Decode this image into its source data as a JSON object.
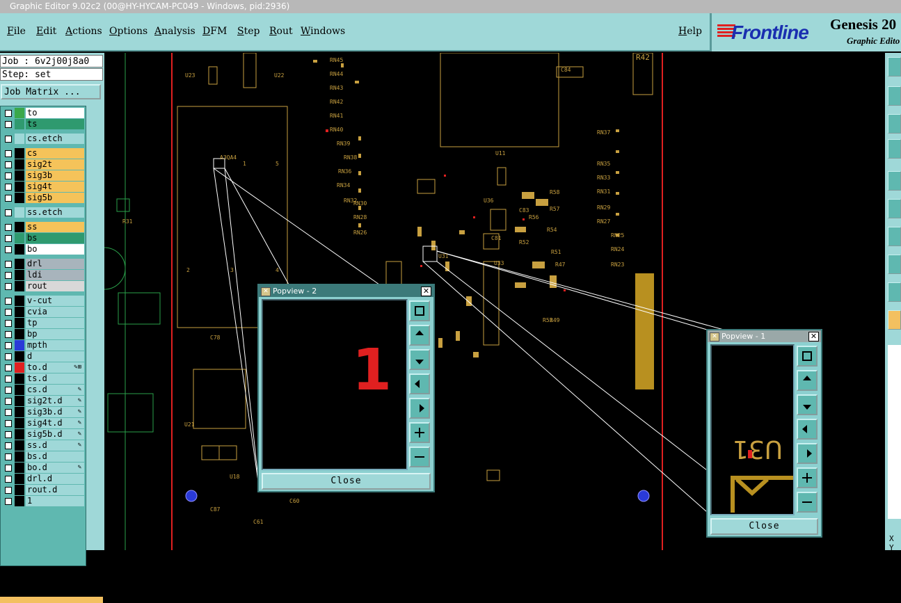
{
  "window": {
    "title": "Graphic Editor 9.02c2 (00@HY-HYCAM-PC049 - Windows, pid:2936)"
  },
  "menu": {
    "items": [
      "File",
      "Edit",
      "Actions",
      "Options",
      "Analysis",
      "DFM",
      "Step",
      "Rout",
      "Windows"
    ],
    "help": "Help"
  },
  "logo": {
    "brand": "Frontline",
    "product": "Genesis 20",
    "subtitle": "Graphic Edito"
  },
  "job": {
    "job_line": "Job : 6v2j00j8a0",
    "step_line": "Step: set",
    "job_matrix_button": "Job Matrix ..."
  },
  "layers": [
    {
      "name": "to",
      "color": "#ffffff",
      "swatch": "#3aa84a"
    },
    {
      "name": "ts",
      "color": "#2f9a6f",
      "swatch": "#2f9a6f"
    },
    {
      "name": "cs.etch",
      "color": "#9fd8d8",
      "swatch": "#9fd8d8"
    },
    {
      "name": "cs",
      "color": "#f5c35a",
      "swatch": "#000000"
    },
    {
      "name": "sig2t",
      "color": "#f5c35a",
      "swatch": "#000000"
    },
    {
      "name": "sig3b",
      "color": "#f5c35a",
      "swatch": "#000000"
    },
    {
      "name": "sig4t",
      "color": "#f5c35a",
      "swatch": "#000000"
    },
    {
      "name": "sig5b",
      "color": "#f5c35a",
      "swatch": "#000000"
    },
    {
      "name": "ss.etch",
      "color": "#9fd8d8",
      "swatch": "#9fd8d8"
    },
    {
      "name": "ss",
      "color": "#f5c35a",
      "swatch": "#000000"
    },
    {
      "name": "bs",
      "color": "#2f9a6f",
      "swatch": "#2f9a6f"
    },
    {
      "name": "bo",
      "color": "#ffffff",
      "swatch": "#000000"
    },
    {
      "name": "drl",
      "color": "#a8b4bc",
      "swatch": "#000000"
    },
    {
      "name": "ldi",
      "color": "#a8b4bc",
      "swatch": "#000000"
    },
    {
      "name": "rout",
      "color": "#d8d8d8",
      "swatch": "#000000"
    },
    {
      "name": "v-cut",
      "color": "#9fd8d8",
      "swatch": "#000000"
    },
    {
      "name": "cvia",
      "color": "#9fd8d8",
      "swatch": "#000000"
    },
    {
      "name": "tp",
      "color": "#9fd8d8",
      "swatch": "#000000"
    },
    {
      "name": "bp",
      "color": "#9fd8d8",
      "swatch": "#000000"
    },
    {
      "name": "mpth",
      "color": "#9fd8d8",
      "swatch": "#2a3ad8"
    },
    {
      "name": "d",
      "color": "#9fd8d8",
      "swatch": "#000000"
    },
    {
      "name": "to.d",
      "color": "#9fd8d8",
      "swatch": "#e02020",
      "edit": "✎⊞"
    },
    {
      "name": "ts.d",
      "color": "#9fd8d8",
      "swatch": "#000000"
    },
    {
      "name": "cs.d",
      "color": "#9fd8d8",
      "swatch": "#000000",
      "edit": "✎"
    },
    {
      "name": "sig2t.d",
      "color": "#9fd8d8",
      "swatch": "#000000",
      "edit": "✎"
    },
    {
      "name": "sig3b.d",
      "color": "#9fd8d8",
      "swatch": "#000000",
      "edit": "✎"
    },
    {
      "name": "sig4t.d",
      "color": "#9fd8d8",
      "swatch": "#000000",
      "edit": "✎"
    },
    {
      "name": "sig5b.d",
      "color": "#9fd8d8",
      "swatch": "#000000",
      "edit": "✎"
    },
    {
      "name": "ss.d",
      "color": "#9fd8d8",
      "swatch": "#000000",
      "edit": "✎"
    },
    {
      "name": "bs.d",
      "color": "#9fd8d8",
      "swatch": "#000000"
    },
    {
      "name": "bo.d",
      "color": "#9fd8d8",
      "swatch": "#000000",
      "edit": "✎"
    },
    {
      "name": "drl.d",
      "color": "#9fd8d8",
      "swatch": "#000000"
    },
    {
      "name": "rout.d",
      "color": "#9fd8d8",
      "swatch": "#000000"
    },
    {
      "name": "1",
      "color": "#9fd8d8",
      "swatch": "#000000"
    }
  ],
  "popview2": {
    "title": "Popview - 2",
    "preview_text": "1",
    "close_label": "Close"
  },
  "popview1": {
    "title": "Popview - 1",
    "preview_text": "U31",
    "close_label": "Close"
  },
  "pcb_labels": [
    "U23",
    "U22",
    "RN45",
    "RN44",
    "RN43",
    "RN42",
    "RN41",
    "RN40",
    "RN39",
    "RN38",
    "RN37",
    "RN36",
    "RN35",
    "RN34",
    "RN33",
    "RN32",
    "RN31",
    "RN30",
    "RN29",
    "RN28",
    "RN27",
    "RN26",
    "RN25",
    "RN24",
    "RN23",
    "U11",
    "U31",
    "U33",
    "U36",
    "C78",
    "U21",
    "U18",
    "C87",
    "C61",
    "C60",
    "R51",
    "R52",
    "R53",
    "R54",
    "R56",
    "R57",
    "R58",
    "C81",
    "C83",
    "C84",
    "R47",
    "R49",
    "R31",
    "R42",
    "A3QA4",
    "1",
    "2",
    "3",
    "4",
    "5",
    "6"
  ],
  "status": {
    "corner_text": "X Y"
  }
}
